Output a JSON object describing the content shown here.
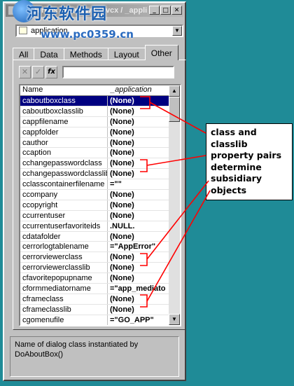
{
  "window": {
    "title": "Properties - framework.vcx / _appli",
    "title_buttons": [
      "_",
      "□",
      "✕"
    ]
  },
  "watermark": {
    "text": "河东软件园",
    "url": "www.pc0359.cn"
  },
  "object_selector": {
    "value": "application"
  },
  "tabs": [
    {
      "label": "All",
      "active": false
    },
    {
      "label": "Data",
      "active": false
    },
    {
      "label": "Methods",
      "active": false
    },
    {
      "label": "Layout",
      "active": false
    },
    {
      "label": "Other",
      "active": true
    }
  ],
  "toolbar": {
    "cancel": "✕",
    "accept": "✓",
    "fx": "fx"
  },
  "grid": {
    "header": {
      "name": "Name",
      "value": "_application"
    },
    "rows": [
      {
        "name": "caboutboxclass",
        "value": "(None)"
      },
      {
        "name": "caboutboxclasslib",
        "value": "(None)"
      },
      {
        "name": "cappfilename",
        "value": "(None)"
      },
      {
        "name": "cappfolder",
        "value": "(None)"
      },
      {
        "name": "cauthor",
        "value": "(None)"
      },
      {
        "name": "ccaption",
        "value": "(None)"
      },
      {
        "name": "cchangepasswordclass",
        "value": "(None)"
      },
      {
        "name": "cchangepasswordclasslib",
        "value": "(None)"
      },
      {
        "name": "cclasscontainerfilename",
        "value": "=\"\""
      },
      {
        "name": "ccompany",
        "value": "(None)"
      },
      {
        "name": "ccopyright",
        "value": "(None)"
      },
      {
        "name": "ccurrentuser",
        "value": "(None)"
      },
      {
        "name": "ccurrentuserfavoriteids",
        "value": ".NULL."
      },
      {
        "name": "cdatafolder",
        "value": "(None)"
      },
      {
        "name": "cerrorlogtablename",
        "value": "=\"AppError\""
      },
      {
        "name": "cerrorviewerclass",
        "value": "(None)"
      },
      {
        "name": "cerrorviewerclasslib",
        "value": "(None)"
      },
      {
        "name": "cfavoritepopupname",
        "value": "(None)"
      },
      {
        "name": "cformmediatorname",
        "value": "=\"app_mediato"
      },
      {
        "name": "cframeclass",
        "value": "(None)"
      },
      {
        "name": "cframeclasslib",
        "value": "(None)"
      },
      {
        "name": "cgomenufile",
        "value": "=\"GO_APP\""
      }
    ],
    "selected_index": 0
  },
  "description": "Name of dialog class instantiated by DoAboutBox()",
  "callout": {
    "text": "class and classlib property pairs determine subsidiary objects"
  },
  "colors": {
    "background": "#1f8b97",
    "selection": "#000080",
    "annotation": "#ff0000"
  }
}
